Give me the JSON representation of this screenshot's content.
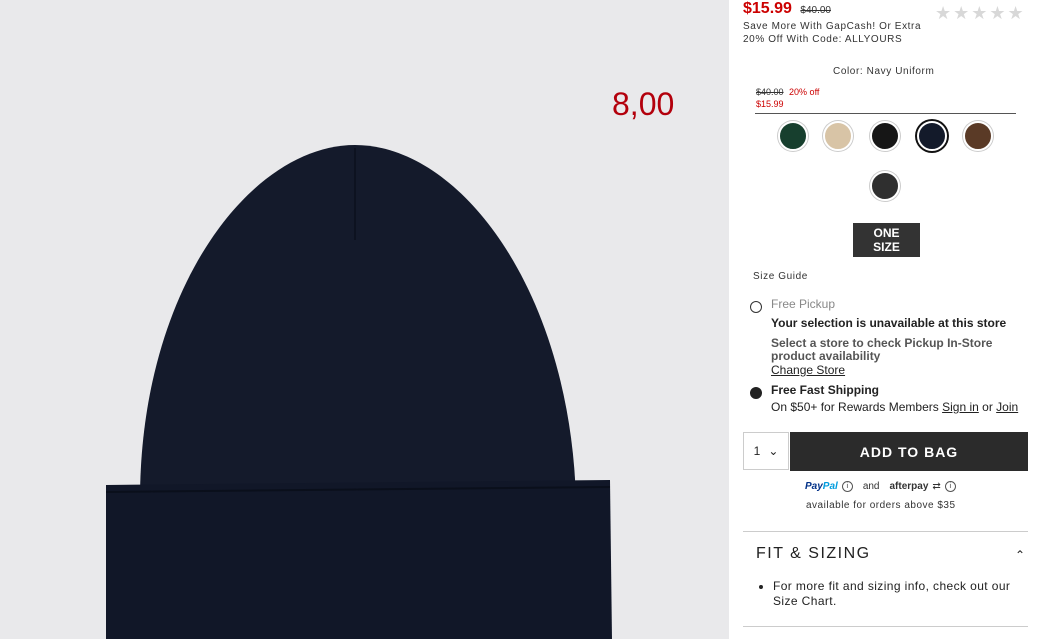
{
  "product_image": {
    "overlay_price": "8,00"
  },
  "price": {
    "current": "$15.99",
    "original": "$40.00"
  },
  "promo": {
    "text": "Save More With GapCash! Or Extra 20% Off With Code: ALLYOURS"
  },
  "rating": {
    "stars": "★★★★★"
  },
  "color": {
    "label": "Color: Navy Uniform",
    "swatch_price": {
      "original": "$40.00",
      "discount": "20% off",
      "current": "$15.99"
    },
    "swatches": [
      {
        "name": "green",
        "color": "#173f2e"
      },
      {
        "name": "oatmeal",
        "color": "#d8c4a6"
      },
      {
        "name": "black",
        "color": "#161616"
      },
      {
        "name": "navy",
        "color": "#131a2a",
        "selected": true
      },
      {
        "name": "brown",
        "color": "#5a3a26"
      },
      {
        "name": "charcoal",
        "color": "#2f2f2f"
      }
    ]
  },
  "size": {
    "option": "ONE SIZE",
    "guide_label": "Size Guide"
  },
  "fulfillment": {
    "pickup": {
      "label": "Free Pickup",
      "unavailable": "Your selection is unavailable at this store",
      "hint": "Select a store to check Pickup In-Store product availability",
      "change_store": "Change Store"
    },
    "shipping": {
      "label": "Free Fast Shipping",
      "detail": "On $50+ for Rewards Members",
      "sign_in": "Sign in",
      "or": "or",
      "join": "Join"
    }
  },
  "cart": {
    "quantity": "1",
    "add_label": "ADD TO BAG"
  },
  "payment": {
    "paypal_a": "Pay",
    "paypal_b": "Pal",
    "and": "and",
    "afterpay": "afterpay",
    "available": "available for orders above $35"
  },
  "fit": {
    "title": "FIT & SIZING",
    "item": "For more fit and sizing info, check out our Size Chart."
  },
  "colors": {
    "sale_red": "#cc0000",
    "button_dark": "#2b2b2b"
  }
}
